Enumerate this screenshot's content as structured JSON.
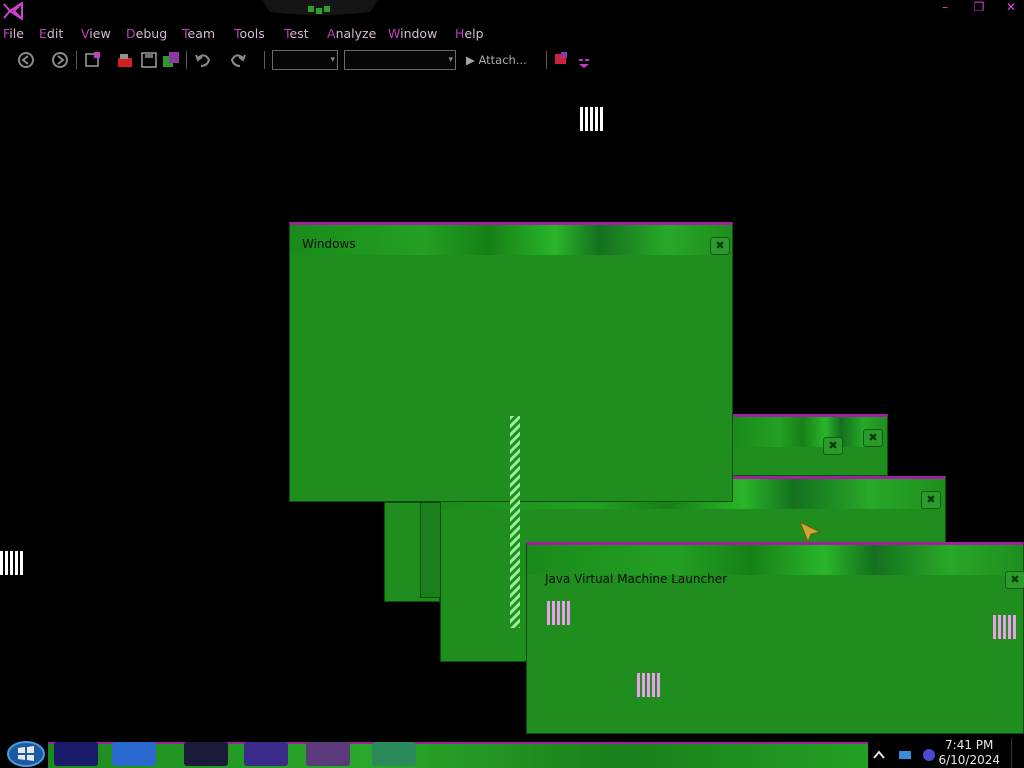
{
  "titlebar": {
    "logo_icon": "visual-studio-logo-icon",
    "minimize_glyph": "–",
    "restore_glyph": "❐",
    "close_glyph": "✕"
  },
  "menubar": {
    "items": [
      "File",
      "Edit",
      "View",
      "Debug",
      "Team",
      "Tools",
      "Test",
      "Analyze",
      "Window",
      "Help"
    ]
  },
  "toolbar": {
    "attach_label": "▶ Attach...",
    "icons": [
      "navigate-back-icon",
      "navigate-forward-icon",
      "new-project-icon",
      "open-file-icon",
      "save-icon",
      "save-all-icon",
      "undo-icon",
      "redo-icon",
      "breakpoint-icon"
    ]
  },
  "windows": {
    "main_title": "Windows",
    "jvm_title": "Java Virtual Machine Launcher",
    "close_glyph": "✖"
  },
  "taskbar": {
    "time": "7:41 PM",
    "date": "6/10/2024"
  },
  "colors": {
    "background": "#000000",
    "window_green": "#1f8e1f",
    "accent_magenta": "#c040c0",
    "artifact_pink": "#e8a0e8"
  }
}
